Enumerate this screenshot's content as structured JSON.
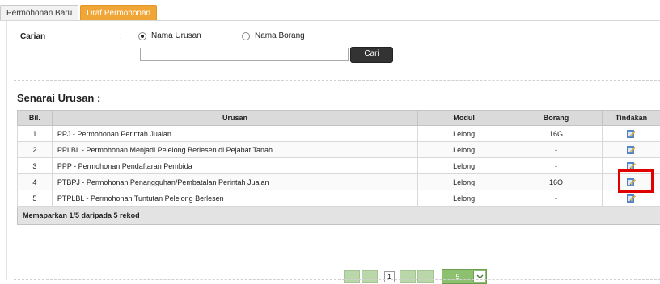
{
  "tabs": [
    {
      "label": "Permohonan Baru",
      "active": false
    },
    {
      "label": "Draf Permohonan",
      "active": true
    }
  ],
  "search": {
    "label": "Carian",
    "colon": ":",
    "options": [
      {
        "label": "Nama Urusan",
        "checked": true
      },
      {
        "label": "Nama Borang",
        "checked": false
      }
    ],
    "input_value": "",
    "button_label": "Cari"
  },
  "list": {
    "title": "Senarai Urusan :",
    "columns": [
      "Bil.",
      "Urusan",
      "Modul",
      "Borang",
      "Tindakan"
    ],
    "rows": [
      {
        "bil": "1",
        "urusan": "PPJ - Permohonan Perintah Jualan",
        "modul": "Lelong",
        "borang": "16G"
      },
      {
        "bil": "2",
        "urusan": "PPLBL - Permohonan Menjadi Pelelong Berlesen di Pejabat Tanah",
        "modul": "Lelong",
        "borang": "-"
      },
      {
        "bil": "3",
        "urusan": "PPP - Permohonan Pendaftaran Pembida",
        "modul": "Lelong",
        "borang": "-"
      },
      {
        "bil": "4",
        "urusan": "PTBPJ - Permohonan Penangguhan/Pembatalan Perintah Jualan",
        "modul": "Lelong",
        "borang": "16O"
      },
      {
        "bil": "5",
        "urusan": "PTPLBL - Permohonan Tuntutan Pelelong Berlesen",
        "modul": "Lelong",
        "borang": "-"
      }
    ],
    "action_icon": "edit-icon",
    "footer": "Memaparkan 1/5 daripada 5 rekod"
  },
  "pager": {
    "current_page": "1",
    "page_size": "5"
  },
  "colors": {
    "tab_active": "#f0a537",
    "header_bg": "#dadada",
    "pager_green": "#b9d7a9",
    "highlight": "#e00000"
  }
}
